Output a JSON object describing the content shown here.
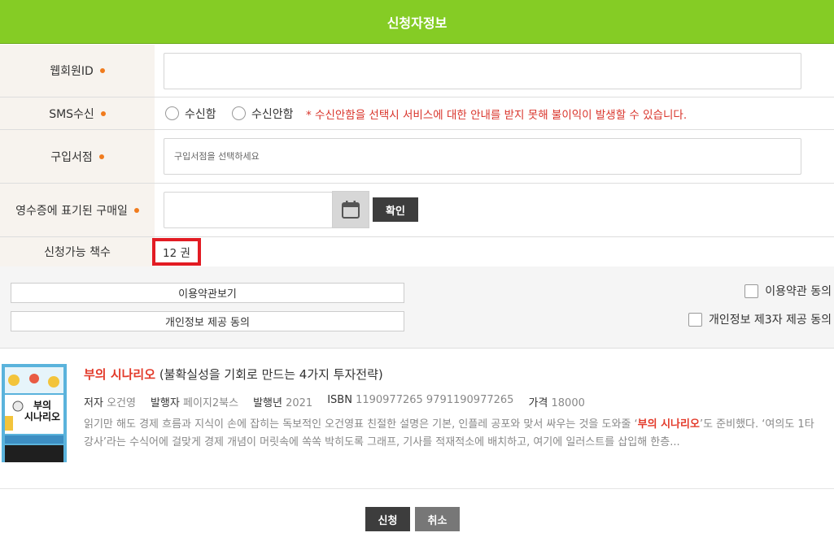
{
  "header": {
    "title": "신청자정보"
  },
  "form": {
    "member_id": {
      "label": "웹회원ID",
      "value": "",
      "placeholder": ""
    },
    "sms": {
      "label": "SMS수신",
      "options": [
        "수신함",
        "수신안함"
      ],
      "note": "* 수신안함을 선택시 서비스에 대한 안내를 받지 못해 불이익이 발생할 수 있습니다."
    },
    "store": {
      "label": "구입서점",
      "placeholder": "구입서점을 선택하세요"
    },
    "purchase_date": {
      "label": "영수증에 표기된 구매일",
      "value": "",
      "confirm_label": "확인"
    },
    "available": {
      "label": "신청가능 책수",
      "count": "12 권"
    }
  },
  "terms": {
    "view_terms_label": "이용약관보기",
    "privacy_label": "개인정보 제공 동의",
    "agree_terms_label": "이용약관 동의",
    "agree_third_party_label": "개인정보 제3자 제공 동의"
  },
  "book": {
    "title": "부의 시나리오",
    "subtitle": "(불확실성을 기회로 만드는 4가지 투자전략)",
    "meta": [
      {
        "key": "저자",
        "value": "오건영"
      },
      {
        "key": "발행자",
        "value": "페이지2북스"
      },
      {
        "key": "발행년",
        "value": "2021"
      },
      {
        "key": "ISBN",
        "value": "1190977265 9791190977265"
      },
      {
        "key": "가격",
        "value": "18000"
      }
    ],
    "desc_before": "읽기만 해도 경제 흐름과 지식이 손에 잡히는 독보적인 오건영표 친절한 설명은 기본, 인플레 공포와 맞서 싸우는 것을 도와줄 ‘",
    "desc_highlight": "부의 시나리오",
    "desc_after": "’도 준비했다. ‘여의도 1타강사’라는 수식어에 걸맞게 경제 개념이 머릿속에 쏙쏙 박히도록 그래프, 기사를 적재적소에 배치하고, 여기에 일러스트를 삽입해 한층...",
    "cover_title": "부의\n시나리오"
  },
  "actions": {
    "submit_label": "신청",
    "cancel_label": "취소"
  },
  "colors": {
    "header_bg": "#85cc25",
    "required_dot": "#f07b1d",
    "warning_text": "#d9342b",
    "highlight_box": "#e21b23",
    "submit_bg": "#3d3d3d",
    "cancel_bg": "#777777"
  }
}
